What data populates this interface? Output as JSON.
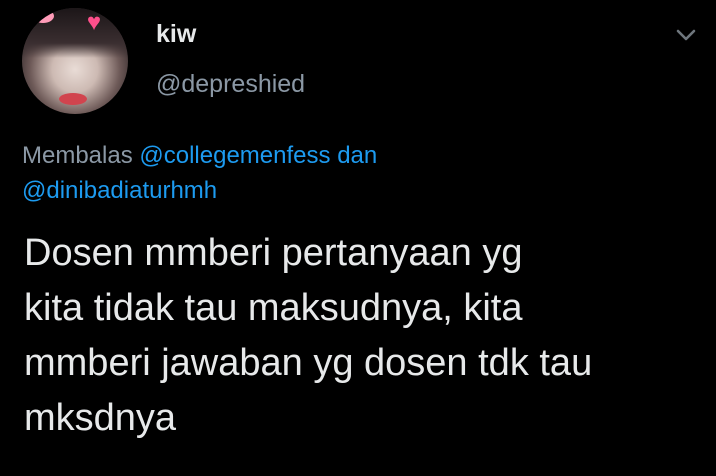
{
  "author": {
    "display_name": "kiw",
    "handle": "@depreshied"
  },
  "reply": {
    "prefix": "Membalas",
    "mention_1": "@collegemenfess",
    "conjunction": "dan",
    "mention_2": "@dinibadiaturhmh"
  },
  "tweet": {
    "lines": [
      "Dosen mmberi pertanyaan yg",
      "kita tidak tau maksudnya, kita",
      "mmberi jawaban yg dosen tdk tau",
      "mksdnya"
    ]
  },
  "icons": {
    "menu": "chevron-down-icon"
  },
  "colors": {
    "background": "#000000",
    "text": "#e7e9ea",
    "muted": "#8b98a5",
    "link": "#1d9bf0"
  }
}
